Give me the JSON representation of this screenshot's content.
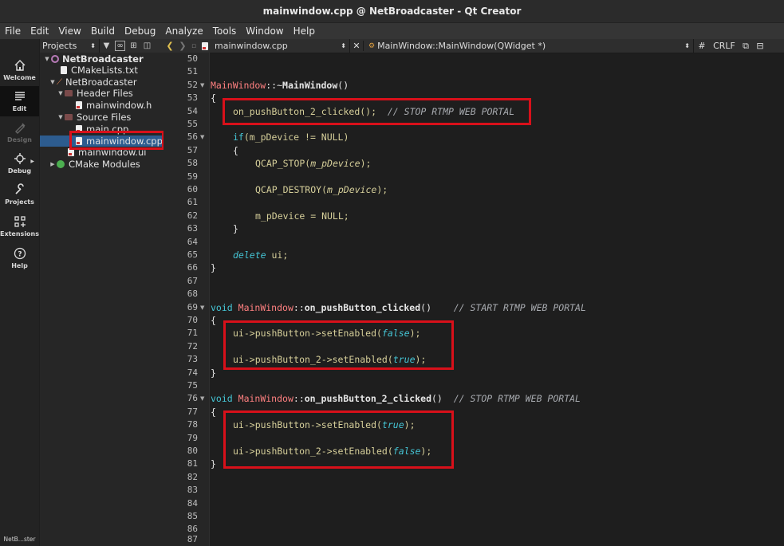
{
  "window": {
    "title": "mainwindow.cpp @ NetBroadcaster - Qt Creator"
  },
  "menu": [
    "File",
    "Edit",
    "View",
    "Build",
    "Debug",
    "Analyze",
    "Tools",
    "Window",
    "Help"
  ],
  "modes": [
    {
      "label": "Welcome",
      "icon": "home-icon"
    },
    {
      "label": "Edit",
      "icon": "edit-icon"
    },
    {
      "label": "Design",
      "icon": "design-icon"
    },
    {
      "label": "Debug",
      "icon": "debug-icon"
    },
    {
      "label": "Projects",
      "icon": "wrench-icon"
    },
    {
      "label": "Extensions",
      "icon": "extensions-icon"
    },
    {
      "label": "Help",
      "icon": "help-icon"
    }
  ],
  "bottom_target": "NetB...ster",
  "sidebar": {
    "selector": "Projects",
    "tree": [
      {
        "label": "NetBroadcaster"
      },
      {
        "label": "CMakeLists.txt"
      },
      {
        "label": "NetBroadcaster"
      },
      {
        "label": "Header Files"
      },
      {
        "label": "mainwindow.h"
      },
      {
        "label": "Source Files"
      },
      {
        "label": "main.cpp"
      },
      {
        "label": "mainwindow.cpp"
      },
      {
        "label": "mainwindow.ui"
      },
      {
        "label": "CMake Modules"
      }
    ]
  },
  "editor": {
    "file_tab": "mainwindow.cpp",
    "symbol": "MainWindow::MainWindow(QWidget *)",
    "hash": "#",
    "line_ending": "CRLF",
    "line_numbers": [
      "50",
      "51",
      "52",
      "53",
      "54",
      "55",
      "56",
      "57",
      "58",
      "59",
      "60",
      "61",
      "62",
      "63",
      "64",
      "65",
      "66",
      "67",
      "68",
      "69",
      "70",
      "71",
      "72",
      "73",
      "74",
      "75",
      "76",
      "77",
      "78",
      "79",
      "80",
      "81",
      "82",
      "83",
      "84",
      "85",
      "86",
      "87"
    ],
    "code": {
      "l52a": "MainWindow",
      "l52b": "::~",
      "l52c": "MainWindow",
      "l52d": "()",
      "brace_open": "{",
      "brace_close": "}",
      "l54a": "on_pushButton_2_clicked();  ",
      "l54b": "// STOP RTMP WEB PORTAL",
      "l56a": "if",
      "l56b": "(m_pDevice != NULL)",
      "l58a": "QCAP_STOP(",
      "l58b": "m_pDevice",
      "l58c": ");",
      "l60a": "QCAP_DESTROY(",
      "l60b": "m_pDevice",
      "l60c": ");",
      "l62": "m_pDevice = NULL;",
      "l65a": "delete",
      "l65b": " ui;",
      "void": "void",
      "cls": "MainWindow",
      "scope": "::",
      "fn1": "on_pushButton_clicked",
      "paren": "()",
      "cmt1": "// START RTMP WEB PORTAL",
      "fn2": "on_pushButton_2_clicked",
      "cmt2": "// STOP RTMP WEB PORTAL",
      "set1": "ui->pushButton->setEnabled(",
      "set2": "ui->pushButton_2->setEnabled(",
      "close": ");",
      "false": "false",
      "true": "true"
    }
  },
  "colors": {
    "highlight": "#d8101a",
    "selection": "#2d5c8f"
  }
}
